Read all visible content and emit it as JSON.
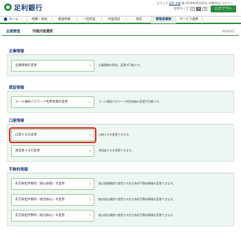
{
  "header": {
    "bank_name": "足利銀行",
    "user_prefix": "ようこそ",
    "user_name": "足利 太郎",
    "user_suffix": "様 2016年06月24日 10時30分 ログイン",
    "text_size_label": "文字サイズ",
    "text_sizes": [
      "小",
      "中",
      "大"
    ],
    "logout_label": "ログアウト"
  },
  "nav": {
    "items": [
      {
        "label": "ホーム",
        "active": false
      },
      {
        "label": "明細・照会",
        "active": false
      },
      {
        "label": "資金移動",
        "active": false
      },
      {
        "label": "一括伝送",
        "active": false
      },
      {
        "label": "代金回収",
        "active": false
      },
      {
        "label": "承認",
        "active": false
      },
      {
        "label": "管理者業務",
        "active": true
      },
      {
        "label": "サービス連携",
        "active": false
      }
    ]
  },
  "page": {
    "breadcrumb_main": "企業管理",
    "breadcrumb_sub": "作業内容選択",
    "screen_code": "BKSK001"
  },
  "sections": [
    {
      "title": "企業情報",
      "items": [
        {
          "label": "企業情報の変更",
          "desc": "企業情報の照会、変更が可能です。",
          "selected": false
        }
      ]
    },
    {
      "title": "認証情報",
      "items": [
        {
          "label": "メール通知パスワード利用有無の変更",
          "desc": "メール通知パスワード利用有無の変更が可能です。",
          "selected": false
        }
      ]
    },
    {
      "title": "口座情報",
      "items": [
        {
          "label": "口座メモの変更",
          "desc": "口座メモを変更できます。",
          "selected": true
        },
        {
          "label": "承認者メモの変更",
          "desc": "承認者メモを変更できます。",
          "selected": false
        }
      ]
    },
    {
      "title": "手数料情報",
      "items": [
        {
          "label": "先方負担手数料（振込振替）の変更",
          "desc": "振込振替業務で使用する先方負担手数料情報を変更できます。",
          "selected": false
        },
        {
          "label": "先方負担手数料（総合振込）の変更",
          "desc": "総合振込業務で使用する先方負担手数料情報を変更できます。",
          "selected": false
        },
        {
          "label": "先方負担手数料（給与振込）の変更",
          "desc": "給与振込業務で使用する先方負担手数料情報を変更できます。",
          "selected": false
        }
      ]
    }
  ],
  "colors": {
    "brand_green": "#2b8a3e",
    "brand_navy": "#1f3f7a",
    "selection_red": "#d9261c",
    "panel_bg": "#eef6f1"
  }
}
